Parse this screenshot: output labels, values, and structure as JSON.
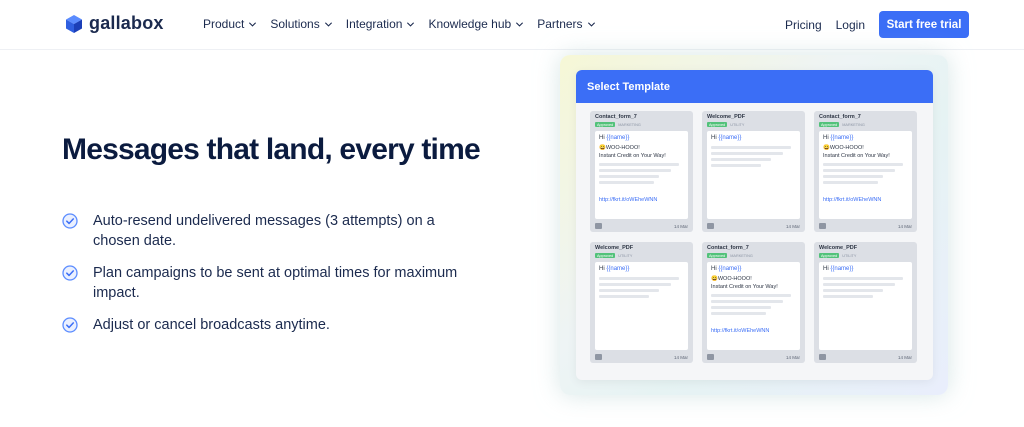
{
  "brand": {
    "name": "gallabox",
    "logo_icon": "cube-logo-icon",
    "accent": "#3b6ef6"
  },
  "nav": {
    "items": [
      {
        "label": "Product"
      },
      {
        "label": "Solutions"
      },
      {
        "label": "Integration"
      },
      {
        "label": "Knowledge hub"
      },
      {
        "label": "Partners"
      }
    ],
    "pricing": "Pricing",
    "login": "Login",
    "cta": "Start free trial"
  },
  "hero": {
    "headline": "Messages that land, every time",
    "features": [
      "Auto-resend undelivered messages (3 attempts) on a chosen date.",
      "Plan campaigns to be sent at optimal times for maximum impact.",
      "Adjust or cancel broadcasts anytime."
    ],
    "feature_icon": "check-circle-icon"
  },
  "template_panel": {
    "title": "Select Template",
    "cards": [
      {
        "name": "Contact_form_7",
        "status": "Approved",
        "category": "MARKETING",
        "greeting": "Hi",
        "variable": "{{name}}",
        "line1": "😀WOO-HOOO!",
        "line2": "Instant Credit on Your Way!",
        "link": "http://fkrt.it/oWEheWNN",
        "date": "14 Mar"
      },
      {
        "name": "Welcome_PDF",
        "status": "Approved",
        "category": "UTILITY",
        "greeting": "Hi",
        "variable": "{{name}}",
        "line1": "",
        "line2": "",
        "link": "",
        "date": "14 Mar"
      },
      {
        "name": "Contact_form_7",
        "status": "Approved",
        "category": "MARKETING",
        "greeting": "Hi",
        "variable": "{{name}}",
        "line1": "😀WOO-HOOO!",
        "line2": "Instant Credit on Your Way!",
        "link": "http://fkrt.it/oWEheWNN",
        "date": "14 Mar"
      },
      {
        "name": "Welcome_PDF",
        "status": "Approved",
        "category": "UTILITY",
        "greeting": "Hi",
        "variable": "{{name}}",
        "line1": "",
        "line2": "",
        "link": "",
        "date": "14 Mar"
      },
      {
        "name": "Contact_form_7",
        "status": "Approved",
        "category": "MARKETING",
        "greeting": "Hi",
        "variable": "{{name}}",
        "line1": "😀WOO-HOOO!",
        "line2": "Instant Credit on Your Way!",
        "link": "http://fkrt.it/oWEheWNN",
        "date": "14 Mar"
      },
      {
        "name": "Welcome_PDF",
        "status": "Approved",
        "category": "UTILITY",
        "greeting": "Hi",
        "variable": "{{name}}",
        "line1": "",
        "line2": "",
        "link": "",
        "date": "14 Mar"
      }
    ]
  }
}
